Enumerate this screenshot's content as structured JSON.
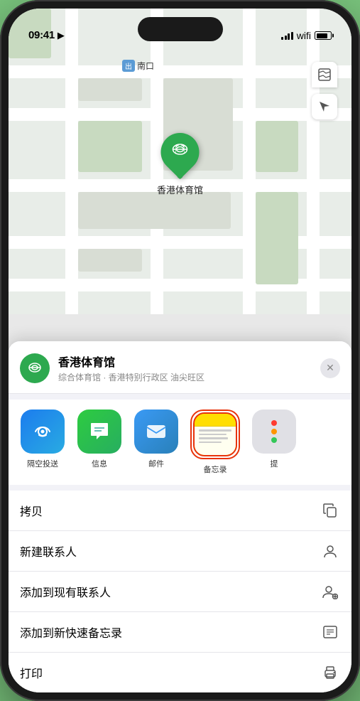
{
  "statusBar": {
    "time": "09:41",
    "locationIcon": "▶"
  },
  "map": {
    "label": "南口",
    "labelTag": "出",
    "stadiumName": "香港体育馆",
    "stadiumEmoji": "🏟"
  },
  "mapControls": {
    "mapViewIcon": "🗺",
    "locationIcon": "➤"
  },
  "venueCard": {
    "name": "香港体育馆",
    "subtitle": "综合体育馆 · 香港特别行政区 油尖旺区",
    "iconEmoji": "🏟",
    "closeLabel": "×"
  },
  "shareItems": [
    {
      "id": "airdrop",
      "label": "隔空投送",
      "type": "airdrop"
    },
    {
      "id": "message",
      "label": "信息",
      "type": "message"
    },
    {
      "id": "mail",
      "label": "邮件",
      "type": "mail"
    },
    {
      "id": "notes",
      "label": "备忘录",
      "type": "notes"
    },
    {
      "id": "more",
      "label": "提",
      "type": "more"
    }
  ],
  "actionItems": [
    {
      "id": "copy",
      "label": "拷贝",
      "iconType": "copy"
    },
    {
      "id": "new-contact",
      "label": "新建联系人",
      "iconType": "person-add"
    },
    {
      "id": "add-existing",
      "label": "添加到现有联系人",
      "iconType": "person-badge-plus"
    },
    {
      "id": "add-notes",
      "label": "添加到新快速备忘录",
      "iconType": "notes"
    },
    {
      "id": "print",
      "label": "打印",
      "iconType": "printer"
    }
  ]
}
